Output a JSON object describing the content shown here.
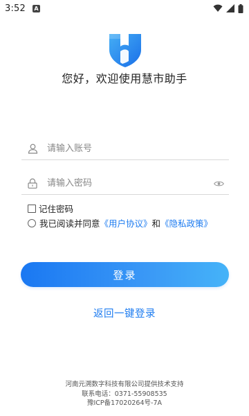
{
  "status_bar": {
    "time": "3:52",
    "notification_badge": "A",
    "icons": [
      "wifi-icon",
      "signal-icon",
      "battery-icon"
    ]
  },
  "greeting": "您好，欢迎使用慧市助手",
  "account_field": {
    "value": "",
    "placeholder": "请输入账号",
    "icon": "user-icon"
  },
  "password_field": {
    "value": "",
    "placeholder": "请输入密码",
    "icon": "lock-icon",
    "toggle_icon": "eye-icon"
  },
  "remember": {
    "label": "记住密码",
    "checked": false
  },
  "agreement": {
    "prefix": "我已阅读并同意",
    "user_agreement": "《用户协议》",
    "conjunction": "和",
    "privacy_policy": "《隐私政策》",
    "checked": false
  },
  "login_button": {
    "label": "登录"
  },
  "back_link": {
    "label": "返回一键登录"
  },
  "footer": {
    "support": "河南元溯数字科技有限公司提供技术支持",
    "phone": "联系电话：0371-55908535",
    "icp": "豫ICP备17020264号-7A"
  },
  "colors": {
    "accent": "#1e7cf0",
    "button_start": "#1a78f2",
    "button_end": "#45b3f8",
    "logo": "#2c8ff0"
  }
}
